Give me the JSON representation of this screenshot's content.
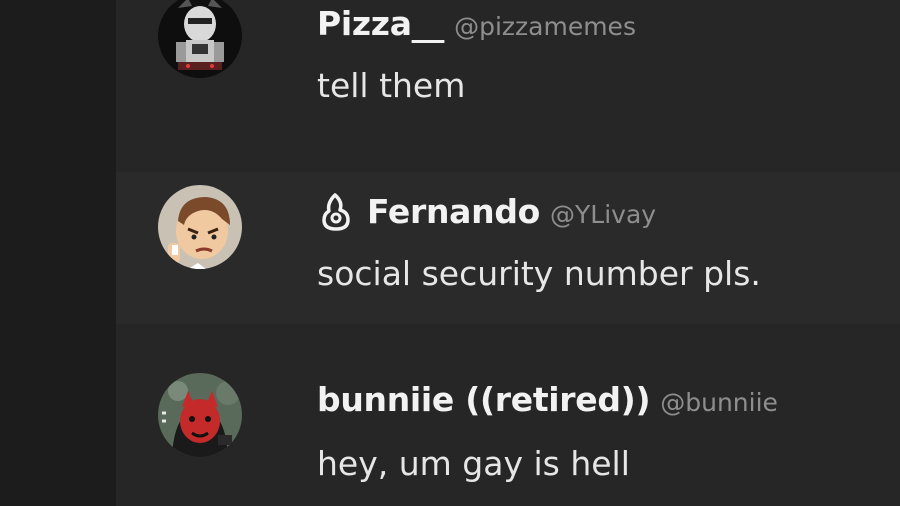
{
  "messages": [
    {
      "display_name": "Pizza__",
      "handle": "@pizzamemes",
      "text": "tell them",
      "avatar_icon": "robot-character-avatar"
    },
    {
      "display_name": "Fernando",
      "handle": "@YLivay",
      "text": "social security number pls.",
      "avatar_icon": "cartoon-face-avatar",
      "badge_icon": "hand-gesture-icon"
    },
    {
      "display_name": "bunniie ((retired))",
      "handle": "@bunniie",
      "text": "hey, um gay is hell",
      "avatar_icon": "red-character-avatar"
    }
  ],
  "colors": {
    "background": "#1a1a1a",
    "message_alt_bg": "#2a2a2a",
    "name_text": "#f2f2f2",
    "handle_text": "#8e8e8e",
    "body_text": "#e6e6e6"
  }
}
